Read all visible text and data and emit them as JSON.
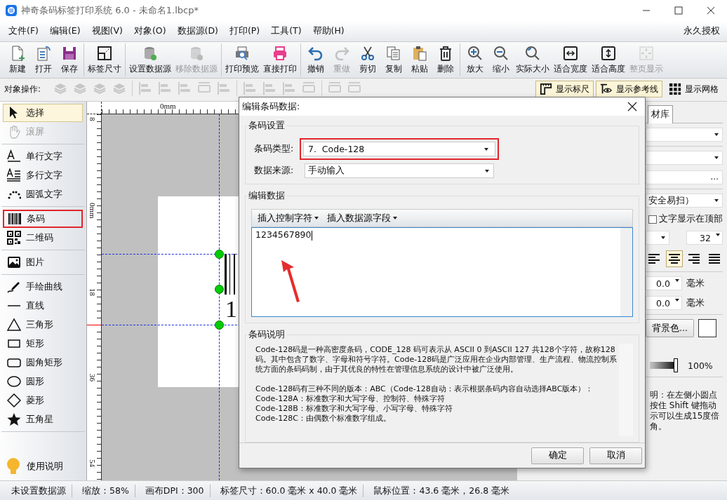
{
  "window": {
    "title": "神奇条码标签打印系统 6.0 - 未命名1.lbcp*"
  },
  "menu": [
    "文件(F)",
    "编辑(E)",
    "视图(V)",
    "对象(O)",
    "数据源(D)",
    "打印(P)",
    "工具(T)",
    "帮助(H)"
  ],
  "license": "永久授权",
  "toolbar": [
    [
      {
        "kind": "new",
        "label": "新建",
        "disabled": false
      },
      {
        "kind": "open",
        "label": "打开",
        "disabled": false
      },
      {
        "kind": "save",
        "label": "保存",
        "disabled": false
      }
    ],
    [
      {
        "kind": "label-size",
        "label": "标签尺寸",
        "disabled": false
      }
    ],
    [
      {
        "kind": "db-add",
        "label": "设置数据源",
        "disabled": false
      },
      {
        "kind": "db-remove",
        "label": "移除数据源",
        "disabled": true
      }
    ],
    [
      {
        "kind": "preview",
        "label": "打印预览",
        "disabled": false
      },
      {
        "kind": "print",
        "label": "直接打印",
        "disabled": false
      }
    ],
    [
      {
        "kind": "undo",
        "label": "撤销",
        "disabled": false
      },
      {
        "kind": "redo",
        "label": "重做",
        "disabled": true
      },
      {
        "kind": "cut",
        "label": "剪切",
        "disabled": false
      },
      {
        "kind": "copy",
        "label": "复制",
        "disabled": false
      },
      {
        "kind": "paste",
        "label": "粘贴",
        "disabled": false
      },
      {
        "kind": "delete",
        "label": "删除",
        "disabled": false
      }
    ],
    [
      {
        "kind": "zoom-in",
        "label": "放大",
        "disabled": false
      },
      {
        "kind": "zoom-out",
        "label": "缩小",
        "disabled": false
      },
      {
        "kind": "zoom-actual",
        "label": "实际大小",
        "disabled": false
      },
      {
        "kind": "fit-width",
        "label": "适合宽度",
        "disabled": false
      },
      {
        "kind": "fit-height",
        "label": "适合高度",
        "disabled": false
      },
      {
        "kind": "fit-page",
        "label": "整页显示",
        "disabled": true
      }
    ]
  ],
  "object_bar": {
    "label": "对象操作:",
    "tools": [
      [
        {
          "kind": "layers",
          "disabled": true
        },
        {
          "kind": "layers",
          "disabled": true
        },
        {
          "kind": "layers",
          "disabled": true
        },
        {
          "kind": "layers",
          "disabled": true
        }
      ],
      [
        {
          "kind": "align",
          "disabled": true
        },
        {
          "kind": "align",
          "disabled": true
        },
        {
          "kind": "align",
          "disabled": true
        },
        {
          "kind": "spacing",
          "disabled": true
        },
        {
          "kind": "align",
          "disabled": true
        }
      ],
      [
        {
          "kind": "align",
          "disabled": true
        },
        {
          "kind": "align",
          "disabled": true
        },
        {
          "kind": "align",
          "disabled": true
        },
        {
          "kind": "spacing",
          "disabled": true
        }
      ],
      [
        {
          "kind": "spacing",
          "disabled": true
        },
        {
          "kind": "spacing",
          "disabled": true
        }
      ]
    ],
    "toggles": [
      {
        "kind": "ruler",
        "label": "显示标尺",
        "selected": true
      },
      {
        "kind": "guides",
        "label": "显示参考线",
        "selected": true
      },
      {
        "kind": "grid",
        "label": "显示网格",
        "selected": false
      }
    ]
  },
  "tools": [
    [
      {
        "kind": "pointer",
        "label": "选择",
        "selected": true,
        "disabled": false,
        "highlighted": false
      },
      {
        "kind": "hand",
        "label": "滚屏",
        "selected": false,
        "disabled": true,
        "highlighted": false
      }
    ],
    [
      {
        "kind": "text",
        "label": "单行文字",
        "selected": false,
        "disabled": false,
        "highlighted": false
      },
      {
        "kind": "multitext",
        "label": "多行文字",
        "selected": false,
        "disabled": false,
        "highlighted": false
      },
      {
        "kind": "arctext",
        "label": "圆弧文字",
        "selected": false,
        "disabled": false,
        "highlighted": false
      }
    ],
    [
      {
        "kind": "barcode",
        "label": "条码",
        "selected": false,
        "disabled": false,
        "highlighted": true
      },
      {
        "kind": "qrcode",
        "label": "二维码",
        "selected": false,
        "disabled": false,
        "highlighted": false
      }
    ],
    [
      {
        "kind": "image",
        "label": "图片",
        "selected": false,
        "disabled": false,
        "highlighted": false
      }
    ],
    [
      {
        "kind": "pen",
        "label": "手绘曲线",
        "selected": false,
        "disabled": false,
        "highlighted": false
      },
      {
        "kind": "line",
        "label": "直线",
        "selected": false,
        "disabled": false,
        "highlighted": false
      },
      {
        "kind": "triangle",
        "label": "三角形",
        "selected": false,
        "disabled": false,
        "highlighted": false
      },
      {
        "kind": "rect",
        "label": "矩形",
        "selected": false,
        "disabled": false,
        "highlighted": false
      },
      {
        "kind": "roundrect",
        "label": "圆角矩形",
        "selected": false,
        "disabled": false,
        "highlighted": false
      },
      {
        "kind": "ellipse",
        "label": "圆形",
        "selected": false,
        "disabled": false,
        "highlighted": false
      },
      {
        "kind": "diamond",
        "label": "菱形",
        "selected": false,
        "disabled": false,
        "highlighted": false
      },
      {
        "kind": "star",
        "label": "五角星",
        "selected": false,
        "disabled": false,
        "highlighted": false
      }
    ]
  ],
  "help": {
    "label": "使用说明"
  },
  "canvas": {
    "ruler_h": [
      "0mm"
    ],
    "ruler_v": [
      "8",
      "0mm",
      "18",
      "36",
      "54"
    ],
    "barcode_digit": "1"
  },
  "right_panel": {
    "tabs": [
      {
        "label": "材库",
        "selected": true
      }
    ],
    "more": "...",
    "symbology": "安全易扫）",
    "checkbox": {
      "label": "文字显示在顶部",
      "checked": false
    },
    "font_size": "32",
    "offsets": [
      {
        "value": "0.0",
        "unit": "毫米"
      },
      {
        "value": "0.0",
        "unit": "毫米"
      }
    ],
    "align": [
      {
        "kind": "left",
        "selected": false
      },
      {
        "kind": "center",
        "selected": true
      },
      {
        "kind": "right",
        "selected": false
      },
      {
        "kind": "justify",
        "selected": false
      }
    ],
    "bg_button": "背景色...",
    "opacity": {
      "level": 1,
      "reading": "100%"
    },
    "note_lines": [
      "明：在左侧小圆点",
      "按住 Shift 键拖动",
      "示可以生成15度倍",
      "角。"
    ]
  },
  "dialog": {
    "title": "编辑条码数据:",
    "settings": {
      "legend": "条码设置",
      "fields": [
        {
          "label": "条码类型:",
          "value": "7.  Code-128",
          "highlighted": true
        },
        {
          "label": "数据来源:",
          "value": "手动输入",
          "highlighted": false
        }
      ]
    },
    "edit": {
      "legend": "编辑数据",
      "menus": [
        "插入控制字符",
        "插入数据源字段"
      ],
      "value": "1234567890"
    },
    "description": {
      "legend": "条码说明",
      "paragraphs": [
        [
          "Code-128码是一种高密度条码，CODE_128 码可表示从 ASCII 0 到ASCII 127 共128个字符，故称128码。其中包含了数字、字母和符号字符。Code-128码是广泛应用在企业内部管理、生产流程、物流控制系统方面的条码码制，由于其优良的特性在管理信息系统的设计中被广泛使用。"
        ],
        [
          "Code-128码有三种不同的版本：ABC（Code-128自动：表示根据条码内容自动选择ABC版本）：",
          "Code-128A：标准数字和大写字母、控制符、特殊字符",
          "Code-128B：标准数字和大写字母、小写字母、特殊字符",
          "Code-128C：由偶数个标准数字组成。"
        ]
      ]
    },
    "buttons": [
      "确定",
      "取消"
    ]
  },
  "status_bar": [
    "未设置数据源",
    "缩放：58%",
    "画布DPI：300",
    "标签尺寸：60.0 毫米 x 40.0 毫米",
    "鼠标位置：43.6 毫米，26.8 毫米"
  ]
}
